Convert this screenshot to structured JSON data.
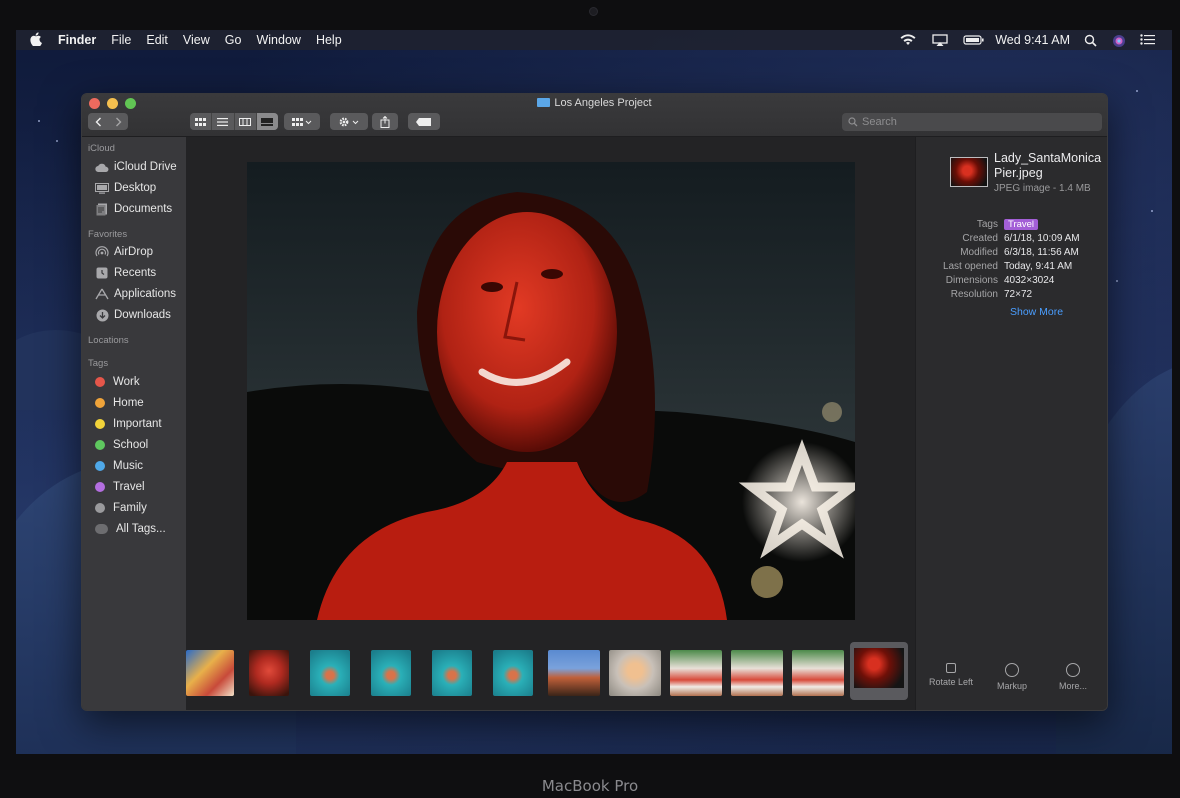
{
  "menubar": {
    "app": "Finder",
    "items": [
      "File",
      "Edit",
      "View",
      "Go",
      "Window",
      "Help"
    ],
    "clock": "Wed 9:41 AM"
  },
  "window": {
    "title": "Los Angeles Project",
    "search_placeholder": "Search"
  },
  "sidebar": {
    "icloud_header": "iCloud",
    "icloud": [
      {
        "label": "iCloud Drive",
        "icon": "cloud-icon"
      },
      {
        "label": "Desktop",
        "icon": "desktop-icon"
      },
      {
        "label": "Documents",
        "icon": "documents-icon"
      }
    ],
    "favorites_header": "Favorites",
    "favorites": [
      {
        "label": "AirDrop",
        "icon": "airdrop-icon"
      },
      {
        "label": "Recents",
        "icon": "clock-icon"
      },
      {
        "label": "Applications",
        "icon": "applications-icon"
      },
      {
        "label": "Downloads",
        "icon": "download-icon"
      }
    ],
    "locations_header": "Locations",
    "tags_header": "Tags",
    "tags": [
      {
        "label": "Work",
        "color": "#e5564a"
      },
      {
        "label": "Home",
        "color": "#f0a43a"
      },
      {
        "label": "Important",
        "color": "#f2d33a"
      },
      {
        "label": "School",
        "color": "#5fc85f"
      },
      {
        "label": "Music",
        "color": "#4fa8e8"
      },
      {
        "label": "Travel",
        "color": "#b46ee0"
      },
      {
        "label": "Family",
        "color": "#9a9a9d"
      },
      {
        "label": "All Tags...",
        "color": "#6d6d70"
      }
    ]
  },
  "inspector": {
    "filename": "Lady_SantaMonicaPier.jpeg",
    "filetype": "JPEG image - 1.4 MB",
    "tags_label": "Tags",
    "tag_value": "Travel",
    "rows": [
      {
        "k": "Created",
        "v": "6/1/18, 10:09 AM"
      },
      {
        "k": "Modified",
        "v": "6/3/18, 11:56 AM"
      },
      {
        "k": "Last opened",
        "v": "Today, 9:41 AM"
      },
      {
        "k": "Dimensions",
        "v": "4032×3024"
      },
      {
        "k": "Resolution",
        "v": "72×72"
      }
    ],
    "show_more": "Show More",
    "actions": [
      "Rotate Left",
      "Markup",
      "More..."
    ]
  },
  "footer": "MacBook Pro"
}
